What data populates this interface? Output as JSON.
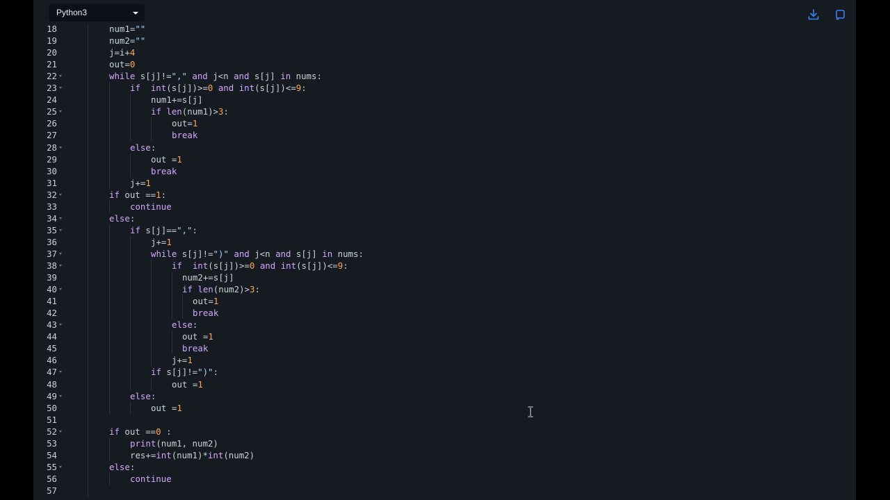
{
  "toolbar": {
    "language": "Python3",
    "download_icon": "download-icon",
    "expand_icon": "expand-icon"
  },
  "colors": {
    "keyword": "#d2a8ff",
    "string": "#a5d6ff",
    "number": "#ffa657",
    "operator": "#ff7b72",
    "text": "#c9d1d9",
    "background": "#161b22"
  },
  "lines": [
    {
      "n": "18",
      "fold": false
    },
    {
      "n": "19",
      "fold": false
    },
    {
      "n": "20",
      "fold": false
    },
    {
      "n": "21",
      "fold": false
    },
    {
      "n": "22",
      "fold": true
    },
    {
      "n": "23",
      "fold": true
    },
    {
      "n": "24",
      "fold": false
    },
    {
      "n": "25",
      "fold": true
    },
    {
      "n": "26",
      "fold": false
    },
    {
      "n": "27",
      "fold": false
    },
    {
      "n": "28",
      "fold": true
    },
    {
      "n": "29",
      "fold": false
    },
    {
      "n": "30",
      "fold": false
    },
    {
      "n": "31",
      "fold": false
    },
    {
      "n": "32",
      "fold": true
    },
    {
      "n": "33",
      "fold": false
    },
    {
      "n": "34",
      "fold": true
    },
    {
      "n": "35",
      "fold": true
    },
    {
      "n": "36",
      "fold": false
    },
    {
      "n": "37",
      "fold": true
    },
    {
      "n": "38",
      "fold": true
    },
    {
      "n": "39",
      "fold": false
    },
    {
      "n": "40",
      "fold": true
    },
    {
      "n": "41",
      "fold": false
    },
    {
      "n": "42",
      "fold": false
    },
    {
      "n": "43",
      "fold": true
    },
    {
      "n": "44",
      "fold": false
    },
    {
      "n": "45",
      "fold": false
    },
    {
      "n": "46",
      "fold": false
    },
    {
      "n": "47",
      "fold": true
    },
    {
      "n": "48",
      "fold": false
    },
    {
      "n": "49",
      "fold": true
    },
    {
      "n": "50",
      "fold": false
    },
    {
      "n": "51",
      "fold": false
    },
    {
      "n": "52",
      "fold": true
    },
    {
      "n": "53",
      "fold": false
    },
    {
      "n": "54",
      "fold": false
    },
    {
      "n": "55",
      "fold": true
    },
    {
      "n": "56",
      "fold": false
    },
    {
      "n": "57",
      "fold": false
    }
  ],
  "code": {
    "l18": [
      "num1=",
      "\"\""
    ],
    "l19": [
      "num2=",
      "\"\""
    ],
    "l20": [
      "j=i+",
      "4"
    ],
    "l21": [
      "out=",
      "0"
    ],
    "l22": [
      "while",
      " s[j]!=",
      "\",\"",
      " and",
      " j<n ",
      "and",
      " s[j] ",
      "in",
      " nums:"
    ],
    "l23": [
      "if",
      "  ",
      "int",
      "(s[j])>=",
      "0",
      " and ",
      "int",
      "(s[j])<=",
      "9",
      ":"
    ],
    "l24": [
      "num1+=s[j]"
    ],
    "l25": [
      "if",
      " ",
      "len",
      "(num1)>",
      "3",
      ":"
    ],
    "l26": [
      "out=",
      "1"
    ],
    "l27": [
      "break"
    ],
    "l28": [
      "else",
      ":"
    ],
    "l29": [
      "out =",
      "1"
    ],
    "l30": [
      "break"
    ],
    "l31": [
      "j+=",
      "1"
    ],
    "l32": [
      "if",
      " out ==",
      "1",
      ":"
    ],
    "l33": [
      "continue"
    ],
    "l34": [
      "else",
      ":"
    ],
    "l35": [
      "if",
      " s[j]==",
      "\",\"",
      ":"
    ],
    "l36": [
      "j+=",
      "1"
    ],
    "l37": [
      "while",
      " s[j]!=",
      "\")\"",
      " and",
      " j<n ",
      "and",
      " s[j] ",
      "in",
      " nums:"
    ],
    "l38": [
      "if",
      "  ",
      "int",
      "(s[j])>=",
      "0",
      " and ",
      "int",
      "(s[j])<=",
      "9",
      ":"
    ],
    "l39": [
      "num2+=s[j]"
    ],
    "l40": [
      "if",
      " ",
      "len",
      "(num2)>",
      "3",
      ":"
    ],
    "l41": [
      "out=",
      "1"
    ],
    "l42": [
      "break"
    ],
    "l43": [
      "else",
      ":"
    ],
    "l44": [
      "out =",
      "1"
    ],
    "l45": [
      "break"
    ],
    "l46": [
      "j+=",
      "1"
    ],
    "l47": [
      "if",
      " s[j]!=",
      "\")\"",
      ":"
    ],
    "l48": [
      "out =",
      "1"
    ],
    "l49": [
      "else",
      ":"
    ],
    "l50": [
      "out =",
      "1"
    ],
    "l51": [
      ""
    ],
    "l52": [
      "if",
      " out ==",
      "0",
      " :"
    ],
    "l53": [
      "print",
      "(num1, num2)"
    ],
    "l54": [
      "res+=",
      "int",
      "(num1)*",
      "int",
      "(num2)"
    ],
    "l55": [
      "else",
      ":"
    ],
    "l56": [
      "continue"
    ],
    "l57": [
      ""
    ]
  }
}
